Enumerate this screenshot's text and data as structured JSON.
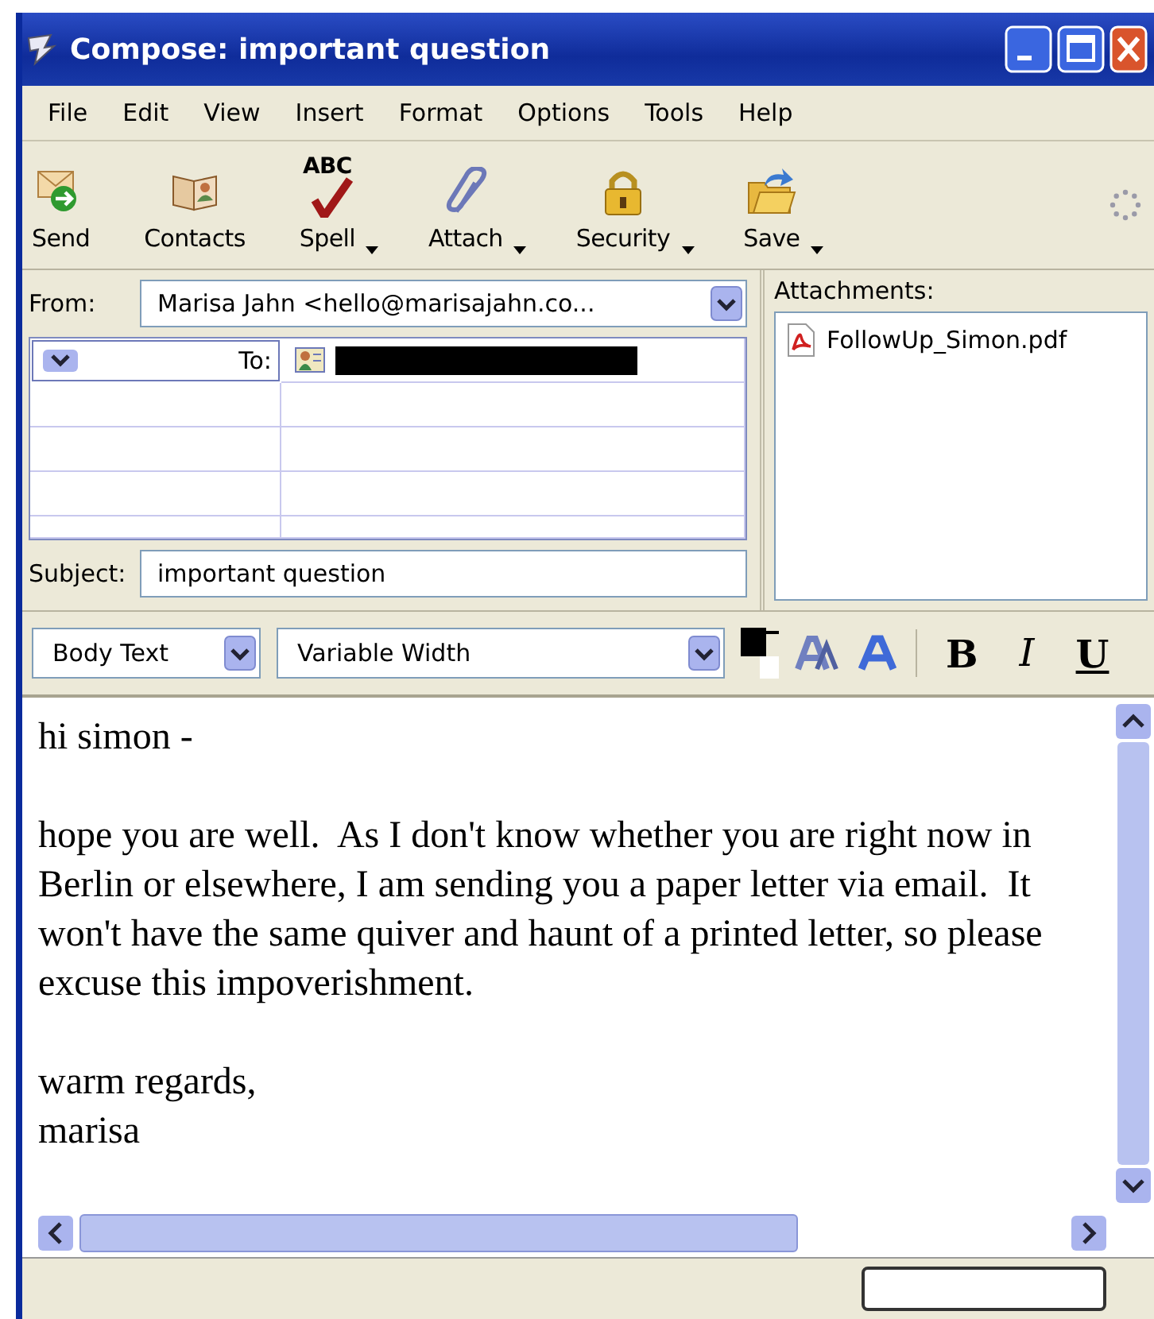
{
  "window": {
    "title": "Compose: important question"
  },
  "menu": [
    "File",
    "Edit",
    "View",
    "Insert",
    "Format",
    "Options",
    "Tools",
    "Help"
  ],
  "toolbar": [
    {
      "label": "Send",
      "dropdown": false
    },
    {
      "label": "Contacts",
      "dropdown": false
    },
    {
      "label": "Spell",
      "icon_text": "ABC",
      "dropdown": true
    },
    {
      "label": "Attach",
      "dropdown": true
    },
    {
      "label": "Security",
      "dropdown": true
    },
    {
      "label": "Save",
      "dropdown": true
    }
  ],
  "from": {
    "label": "From:",
    "value": "Marisa Jahn <hello@marisajahn.co..."
  },
  "recipient": {
    "type": "To:"
  },
  "subject": {
    "label": "Subject:",
    "value": "important question"
  },
  "attachments": {
    "label": "Attachments:",
    "items": [
      {
        "name": "FollowUp_Simon.pdf"
      }
    ]
  },
  "format_bar": {
    "paragraph_style": "Body Text",
    "font": "Variable Width",
    "buttons": [
      {
        "label": "B",
        "kind": "bold"
      },
      {
        "label": "I",
        "kind": "italic"
      },
      {
        "label": "U",
        "kind": "underline"
      }
    ]
  },
  "body": {
    "paragraphs": [
      [
        "hi simon -"
      ],
      [
        "hope you are well.  As I don't know whether you are right now in Berlin or elsewhere, I am sending you a paper letter via email.  It won't have the same quiver and haunt of a printed letter, so please excuse this impoverishment."
      ],
      [
        "warm regards,",
        "marisa"
      ]
    ]
  }
}
